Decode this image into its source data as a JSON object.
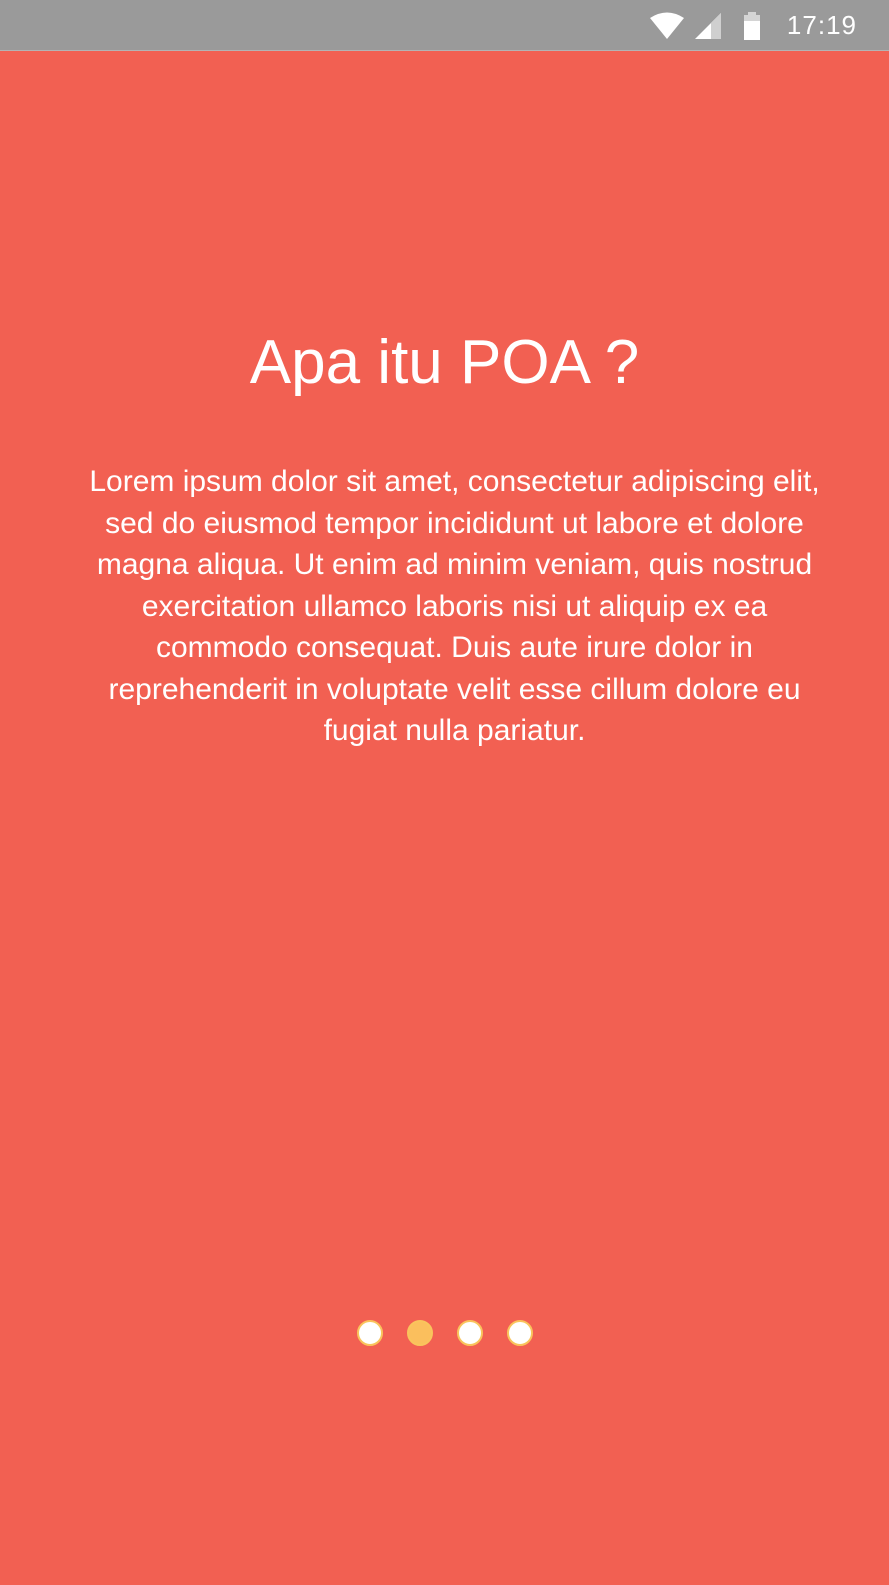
{
  "status_bar": {
    "time": "17:19",
    "icons": [
      "wifi-icon",
      "signal-icon",
      "battery-icon"
    ]
  },
  "onboarding": {
    "title": "Apa itu POA ?",
    "description": "Lorem ipsum dolor sit amet, consectetur adipiscing elit, sed do eiusmod tempor incididunt ut labore et dolore magna aliqua. Ut enim ad minim veniam, quis nostrud exercitation ullamco laboris nisi ut aliquip ex ea commodo consequat. Duis aute irure dolor in reprehenderit in voluptate velit esse cillum dolore eu fugiat nulla pariatur.",
    "page_indicator": {
      "total": 4,
      "active_index": 1
    }
  },
  "colors": {
    "background": "#f26052",
    "status_bar": "#9a9a9a",
    "text": "#ffffff",
    "active_dot": "#fbbf5d",
    "dot_border": "#f9c45c"
  }
}
